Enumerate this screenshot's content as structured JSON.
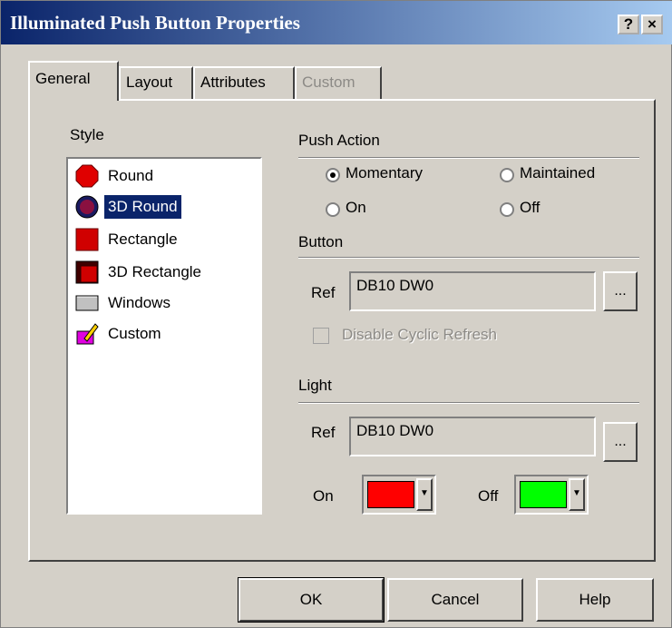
{
  "window": {
    "title": "Illuminated Push Button Properties",
    "help_btn": "?",
    "close_btn": "×"
  },
  "tabs": [
    {
      "label": "General",
      "active": true
    },
    {
      "label": "Layout"
    },
    {
      "label": "Attributes"
    },
    {
      "label": "Custom",
      "disabled": true
    }
  ],
  "style": {
    "label": "Style",
    "items": [
      {
        "label": "Round",
        "icon": "red-octagon-icon"
      },
      {
        "label": "3D Round",
        "icon": "3d-round-icon",
        "selected": true
      },
      {
        "label": "Rectangle",
        "icon": "red-rectangle-icon"
      },
      {
        "label": "3D Rectangle",
        "icon": "3d-rectangle-icon"
      },
      {
        "label": "Windows",
        "icon": "windows-button-icon"
      },
      {
        "label": "Custom",
        "icon": "custom-pencil-icon"
      }
    ]
  },
  "push_action": {
    "label": "Push Action",
    "options": [
      {
        "label": "Momentary",
        "checked": true
      },
      {
        "label": "Maintained"
      },
      {
        "label": "On"
      },
      {
        "label": "Off"
      }
    ]
  },
  "button": {
    "label": "Button",
    "ref_label": "Ref",
    "ref_value": "DB10 DW0",
    "browse_label": "...",
    "disable_cyclic_label": "Disable Cyclic Refresh"
  },
  "light": {
    "label": "Light",
    "ref_label": "Ref",
    "ref_value": "DB10 DW0",
    "browse_label": "...",
    "on_label": "On",
    "on_color": "#ff0000",
    "off_label": "Off",
    "off_color": "#00ff00",
    "dropdown_arrow": "▼"
  },
  "footer": {
    "ok": "OK",
    "cancel": "Cancel",
    "help": "Help"
  }
}
